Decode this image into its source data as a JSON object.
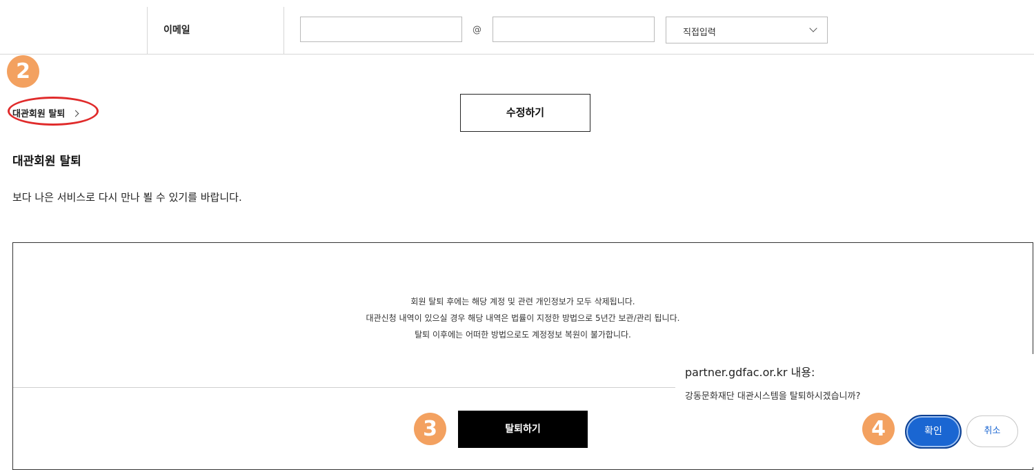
{
  "email_row": {
    "label": "이메일",
    "local_part_value": "",
    "at_sign": "@",
    "domain_value": "",
    "domain_select_value": "직접입력"
  },
  "annotations": {
    "step2": "2",
    "step3": "3",
    "step4": "4",
    "highlight_color": "#e02b2b",
    "badge_color": "#f3a160"
  },
  "withdraw_link": {
    "label": "대관회원 탈퇴"
  },
  "edit_button": {
    "label": "수정하기"
  },
  "withdraw_section": {
    "title": "대관회원 탈퇴",
    "description": "보다 나은 서비스로 다시 만나 뵐 수 있기를 바랍니다.",
    "notice_lines": [
      "회원 탈퇴 후에는 해당 계정 및 관련 개인정보가 모두 삭제됩니다.",
      "대관신청 내역이 있으실 경우 해당 내역은 법률이 지정한 방법으로 5년간 보관/관리 됩니다.",
      "탈퇴 이후에는 어떠한 방법으로도 계정정보 복원이 불가합니다."
    ],
    "withdraw_button": "탈퇴하기"
  },
  "confirm_dialog": {
    "origin": "partner.gdfac.or.kr 내용:",
    "message": "강동문화재단 대관시스템을 탈퇴하시겠습니까?",
    "ok_label": "확인",
    "cancel_label": "취소",
    "accent_color": "#1a66d2"
  }
}
